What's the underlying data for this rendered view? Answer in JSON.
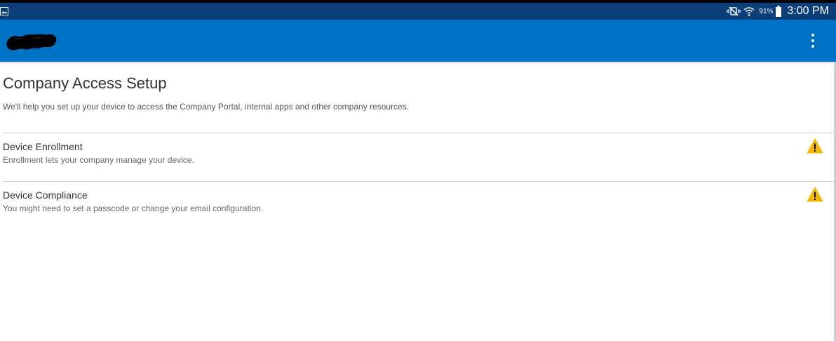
{
  "status_bar": {
    "battery_percent": "91%",
    "time": "3:00 PM",
    "icons": [
      "gallery-icon",
      "mute-vibrate-icon",
      "wifi-icon",
      "battery-icon"
    ]
  },
  "app_bar": {
    "logo": "app-logo",
    "menu_icon": "more-vert-icon"
  },
  "page": {
    "title": "Company Access Setup",
    "subtitle": "We'll help you set up your device to access the Company Portal, internal apps and other company resources."
  },
  "items": [
    {
      "title": "Device Enrollment",
      "description": "Enrollment lets your company manage your device.",
      "status_icon": "warning-icon"
    },
    {
      "title": "Device Compliance",
      "description": "You might need to set a passcode or change your email configuration.",
      "status_icon": "warning-icon"
    }
  ],
  "colors": {
    "status_bar": "#0a3f7a",
    "app_bar": "#0072c6",
    "warning": "#f5b800"
  }
}
